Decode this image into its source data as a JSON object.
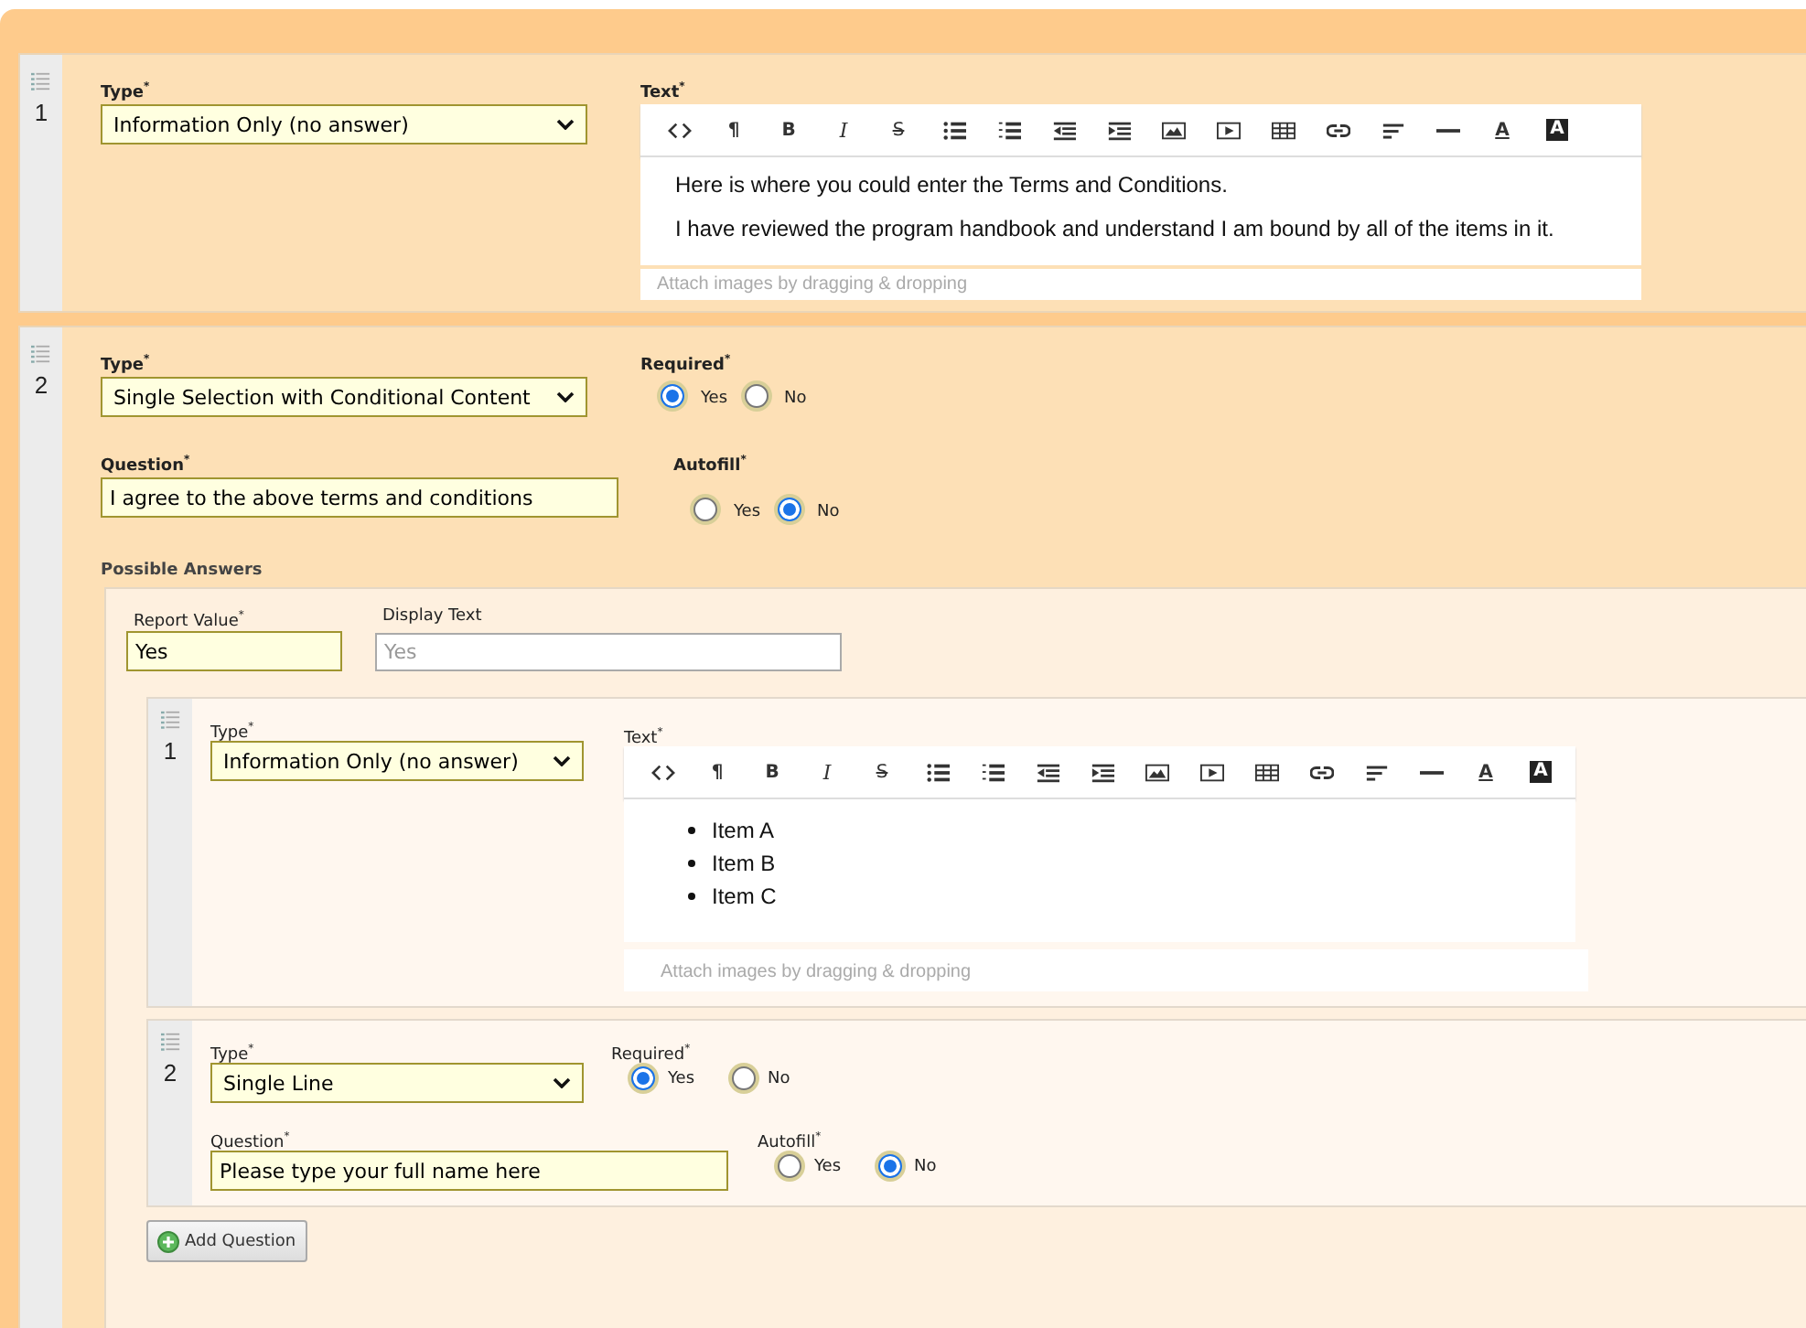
{
  "questions": [
    {
      "number": "1",
      "type_label": "Type$^{*}$",
      "type_value": "Information Only (no answer)",
      "kind": "info",
      "text_label": "Text$^{*}$",
      "editor": {
        "toolbar": [
          {
            "kind": "code"
          },
          {
            "kind": "para",
            "label": "¶"
          },
          {
            "kind": "bold",
            "label": "B"
          },
          {
            "kind": "italic",
            "label": "I"
          },
          {
            "kind": "strike",
            "label": "S"
          },
          {
            "kind": "ul"
          },
          {
            "kind": "ol"
          },
          {
            "kind": "outdent"
          },
          {
            "kind": "indent"
          },
          {
            "kind": "image"
          },
          {
            "kind": "video"
          },
          {
            "kind": "table"
          },
          {
            "kind": "link"
          },
          {
            "kind": "align"
          },
          {
            "kind": "hr"
          },
          {
            "kind": "color",
            "label": "A"
          },
          {
            "kind": "bgcolor",
            "label": "A"
          }
        ],
        "content": {
          "kind": "paragraphs",
          "items": [
            "Here is where you could enter the Terms and Conditions.",
            "I have reviewed the program handbook and understand I am bound by all of the items in it."
          ]
        },
        "attach": "Attach images by dragging & dropping"
      }
    },
    {
      "number": "2",
      "type_label": "Type$^{*}$",
      "type_value": "Single Selection with Conditional Content",
      "kind": "choice",
      "required": {
        "label": "Required$^{*}$",
        "options": [
          {
            "label": "Yes",
            "selected": true
          },
          {
            "label": "No",
            "selected": false
          }
        ]
      },
      "question_label": "Question$^{*}$",
      "question_value": "I agree to the above terms and conditions",
      "autofill": {
        "label": "Autofill$^{*}$",
        "options": [
          {
            "label": "Yes",
            "selected": false
          },
          {
            "label": "No",
            "selected": true
          }
        ]
      },
      "possible_answers": {
        "label": "Possible Answers",
        "answers": [
          {
            "report_label": "Report Value$^{*}$",
            "report_value": "Yes",
            "display_label": "Display Text",
            "display_placeholder": "Yes",
            "add_button": "Add Question",
            "questions": [
              {
                "number": "1",
                "type_label": "Type$^{*}$",
                "type_value": "Information Only (no answer)",
                "kind": "info",
                "text_label": "Text$^{*}$",
                "editor": {
                  "toolbar": [
                    {
                      "kind": "code"
                    },
                    {
                      "kind": "para",
                      "label": "¶"
                    },
                    {
                      "kind": "bold",
                      "label": "B"
                    },
                    {
                      "kind": "italic",
                      "label": "I"
                    },
                    {
                      "kind": "strike",
                      "label": "S"
                    },
                    {
                      "kind": "ul"
                    },
                    {
                      "kind": "ol"
                    },
                    {
                      "kind": "outdent"
                    },
                    {
                      "kind": "indent"
                    },
                    {
                      "kind": "image"
                    },
                    {
                      "kind": "video"
                    },
                    {
                      "kind": "table"
                    },
                    {
                      "kind": "link"
                    },
                    {
                      "kind": "align"
                    },
                    {
                      "kind": "hr"
                    },
                    {
                      "kind": "color",
                      "label": "A"
                    },
                    {
                      "kind": "bgcolor",
                      "label": "A"
                    }
                  ],
                  "content": {
                    "kind": "bullets",
                    "items": [
                      "Item A",
                      "Item B",
                      "Item C"
                    ]
                  },
                  "attach": "Attach images by dragging & dropping"
                }
              },
              {
                "number": "2",
                "type_label": "Type$^{*}$",
                "type_value": "Single Line",
                "kind": "line",
                "required": {
                  "label": "Required$^{*}$",
                  "options": [
                    {
                      "label": "Yes",
                      "selected": true
                    },
                    {
                      "label": "No",
                      "selected": false
                    }
                  ]
                },
                "question_label": "Question$^{*}$",
                "question_value": "Please type your full name here",
                "autofill": {
                  "label": "Autofill$^{*}$",
                  "options": [
                    {
                      "label": "Yes",
                      "selected": false
                    },
                    {
                      "label": "No",
                      "selected": true
                    }
                  ]
                }
              }
            ]
          }
        ]
      }
    }
  ]
}
